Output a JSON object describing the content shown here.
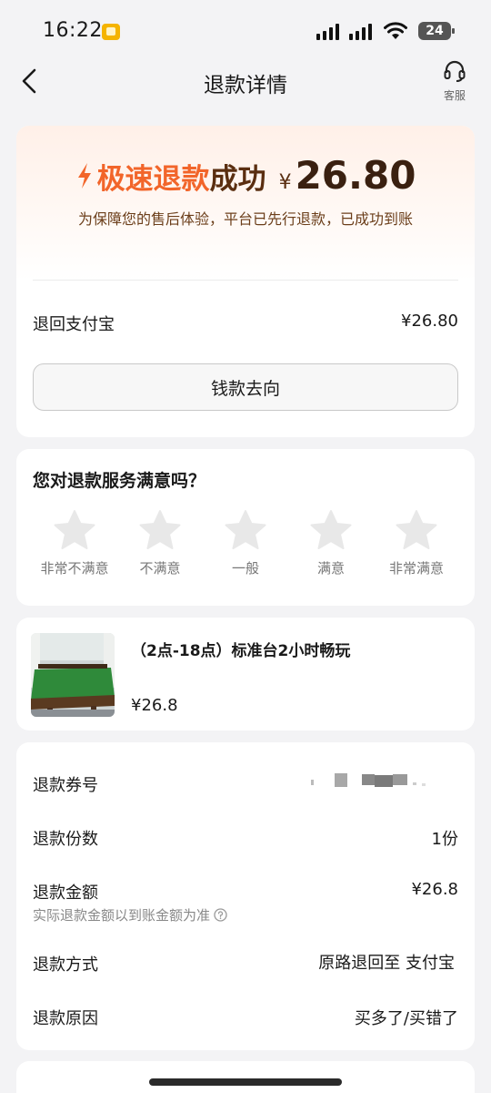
{
  "status_bar": {
    "time": "16:22",
    "battery": "24",
    "app_icon": "notes-app-icon",
    "icons": [
      "signal-icon",
      "signal-icon",
      "wifi-icon",
      "battery-icon"
    ]
  },
  "nav": {
    "title": "退款详情",
    "back_icon": "chevron-left-icon",
    "service_icon": "headset-icon",
    "service_label": "客服"
  },
  "refund_summary": {
    "headline_accent": "极速退款",
    "headline_main": "成功",
    "currency": "¥",
    "amount": "26.80",
    "note": "为保障您的售后体验，平台已先行退款，已成功到账",
    "destination_label": "退回支付宝",
    "destination_amount": "¥26.80",
    "money_flow_button": "钱款去向",
    "accent_color": "#f2652a",
    "text_color": "#5a2e10"
  },
  "rating": {
    "question": "您对退款服务满意吗？",
    "options": [
      {
        "label": "非常不满意",
        "icon": "star-icon"
      },
      {
        "label": "不满意",
        "icon": "star-icon"
      },
      {
        "label": "一般",
        "icon": "star-icon"
      },
      {
        "label": "满意",
        "icon": "star-icon"
      },
      {
        "label": "非常满意",
        "icon": "star-icon"
      }
    ],
    "selected": 0,
    "max": 5
  },
  "product": {
    "title": "（2点-18点）标准台2小时畅玩",
    "price": "¥26.8",
    "image": "billiard-table-photo"
  },
  "details": {
    "rows": [
      {
        "label": "退款券号",
        "value": ""
      },
      {
        "label": "退款份数",
        "value": "1份"
      },
      {
        "label": "退款金额",
        "value": "¥26.8",
        "sub": "实际退款金额以到账金额为准"
      },
      {
        "label": "退款方式",
        "value": "原路退回至 支付宝"
      },
      {
        "label": "退款原因",
        "value": "买多了/买错了"
      }
    ]
  }
}
